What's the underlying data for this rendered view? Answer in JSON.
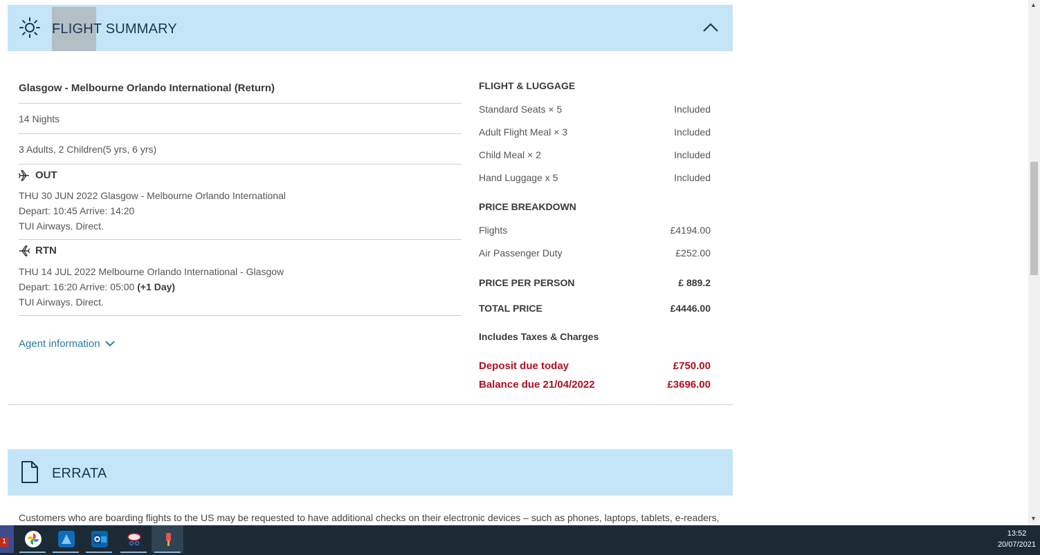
{
  "flight_summary": {
    "title": "FLIGHT SUMMARY",
    "route": "Glasgow - Melbourne Orlando International (Return)",
    "nights": "14 Nights",
    "passengers": "3 Adults, 2 Children(5 yrs, 6 yrs)",
    "out": {
      "label": "OUT",
      "line1": "THU 30 JUN 2022 Glasgow  - Melbourne Orlando International",
      "line2": "Depart: 10:45 Arrive: 14:20",
      "line3": "TUI Airways. Direct."
    },
    "rtn": {
      "label": "RTN",
      "line1": "THU 14 JUL 2022 Melbourne Orlando International - Glasgow",
      "line2_prefix": "Depart: 16:20 Arrive: 05:00 ",
      "line2_bold": "(+1 Day)",
      "line3": "TUI Airways. Direct."
    },
    "agent_info": "Agent information"
  },
  "flight_luggage": {
    "heading": "FLIGHT & LUGGAGE",
    "items": [
      {
        "label": "Standard Seats × 5",
        "value": "Included"
      },
      {
        "label": "Adult Flight Meal × 3",
        "value": "Included"
      },
      {
        "label": "Child Meal × 2",
        "value": "Included"
      },
      {
        "label": "Hand Luggage x 5",
        "value": "Included"
      }
    ]
  },
  "price_breakdown": {
    "heading": "PRICE BREAKDOWN",
    "items": [
      {
        "label": "Flights",
        "value": "£4194.00"
      },
      {
        "label": "Air Passenger Duty",
        "value": "£252.00"
      }
    ],
    "per_person_label": "PRICE PER PERSON",
    "per_person_value": "£ 889.2",
    "total_label": "TOTAL PRICE",
    "total_value": "£4446.00",
    "taxes_note": "Includes Taxes & Charges",
    "deposit_label": "Deposit due today",
    "deposit_value": "£750.00",
    "balance_label": "Balance due 21/04/2022",
    "balance_value": "£3696.00"
  },
  "errata": {
    "title": "ERRATA",
    "text": "Customers who are boarding flights to the US may be requested to have additional checks on their electronic devices – such as phones, laptops, tablets, e-readers,"
  },
  "taskbar": {
    "time": "13:52",
    "date": "20/07/2021",
    "badge": "1",
    "apps": [
      "google-photos-icon",
      "azure-icon",
      "outlook-icon",
      "snipping-tool-icon",
      "paint-icon"
    ]
  },
  "colors": {
    "header_bg": "#c4e5f7",
    "accent_red": "#b00f1f",
    "link_blue": "#2a7aa8",
    "taskbar_bg": "#1b2a35"
  }
}
